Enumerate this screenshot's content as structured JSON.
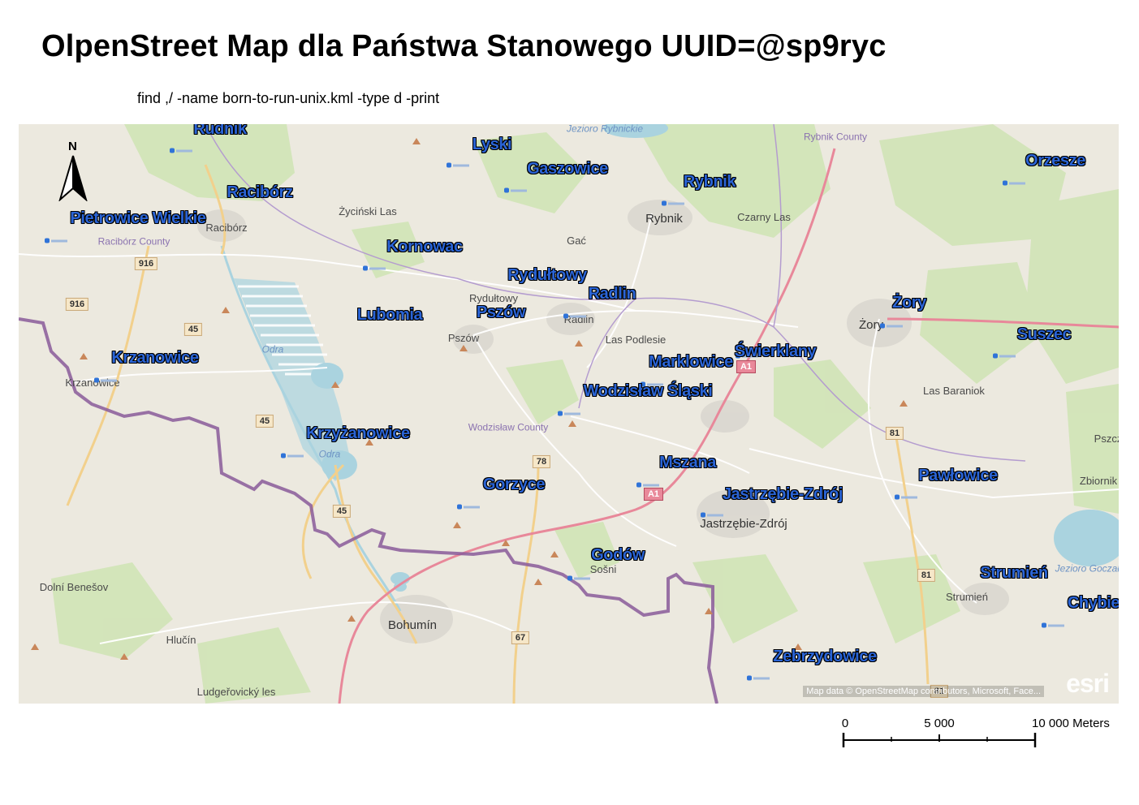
{
  "title": "OlpenStreet Map dla Państwa Stanowego UUID=@sp9ryc",
  "subtitle": "find ,/ -name born-to-run-unix.kml -type d -print",
  "north_arrow": {
    "letter": "N"
  },
  "poi_labels": [
    "Rudnik",
    "Lyski",
    "Gaszowice",
    "Rybnik",
    "Orzesze",
    "Racibórz",
    "Pietrowice Wielkie",
    "Kornowac",
    "Rydułtowy",
    "Radlin",
    "Żory",
    "Lubomia",
    "Pszów",
    "Suszec",
    "Krzanowice",
    "Świerklany",
    "Marklowice",
    "Wodzisław Śląski",
    "Krzyżanowice",
    "Mszana",
    "Pawłowice",
    "Gorzyce",
    "Jastrzębie-Zdrój",
    "Godów",
    "Strumień",
    "Chybie",
    "Zebrzydowice"
  ],
  "base_labels": {
    "rybnik_county": "Rybnik County",
    "jezioro_rybnickie": "Jezioro Rybnickie",
    "zycinski_las": "Życiński Las",
    "rybnik": "Rybnik",
    "czarny_las": "Czarny Las",
    "raciborz": "Racibórz",
    "raciborz_county": "Racibórz County",
    "gac": "Gać",
    "rydultowy": "Rydułtowy",
    "radlin": "Radlin",
    "zory": "Żory",
    "pszow": "Pszów",
    "las_podlesie": "Las Podlesie",
    "odra_1": "Odra",
    "krzanowice": "Krzanowice",
    "las_baranioki": "Las Baraniok",
    "wodzislaw_county": "Wodzisław County",
    "odra_2": "Odra",
    "pszcz": "Pszcz",
    "zbiornik": "Zbiornik",
    "jastrzebie_zdroj": "Jastrzębie-Zdrój",
    "sosni": "Sošni",
    "jezioro_goczalkow": "Jezioro Goczałkow",
    "dolni_benesov": "Dolní Benešov",
    "strumien": "Strumień",
    "bohumin": "Bohumín",
    "hlucin": "Hlučín",
    "ludgerovicky_les": "Ludgeřovický les"
  },
  "road_shields": {
    "r916a": "916",
    "r916b": "916",
    "r45a": "45",
    "r45b": "45",
    "r45c": "45",
    "r78": "78",
    "r81a": "81",
    "r81b": "81",
    "r81c": "81",
    "r67": "67",
    "a1a": "A1",
    "a1b": "A1"
  },
  "attribution": "Map data © OpenStreetMap contributors, Microsoft, Face...",
  "esri_logo": "esri",
  "scale_bar": {
    "labels": [
      "0",
      "5 000",
      "10 000"
    ],
    "unit": "Meters"
  },
  "colors": {
    "poi_text": "#2a64d6",
    "border": "#8a5a9a",
    "motorway": "#e8889a",
    "forest": "#cfe4b4",
    "water": "#aad3df"
  }
}
